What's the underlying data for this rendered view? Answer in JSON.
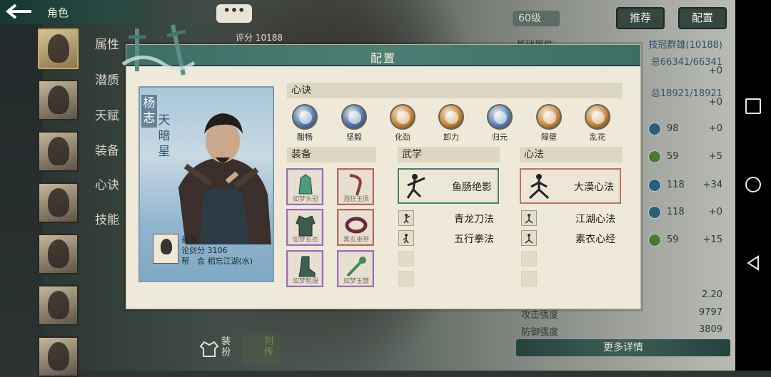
{
  "top": {
    "back_icon": "back-arrow-icon",
    "title": "角色"
  },
  "sidebar_tabs": [
    "属性",
    "潜质",
    "天赋",
    "装备",
    "心诀",
    "技能"
  ],
  "chat_bubble": "•••",
  "score_text": "评分 10188",
  "level": "60级",
  "buttons": {
    "recommend": "推荐",
    "config": "配置"
  },
  "stats": {
    "heading": "基础属性",
    "guild_rank": "技冠群雄(10188)",
    "hp_total": "总66341/66341",
    "hp_bonus": "+0",
    "mp_total": "总18921/18921",
    "mp_bonus": "+0",
    "rows": [
      {
        "value": "98",
        "bonus": "+0"
      },
      {
        "value": "59",
        "bonus": "+5"
      },
      {
        "value": "118",
        "bonus": "+34"
      },
      {
        "value": "118",
        "bonus": "+0"
      },
      {
        "value": "59",
        "bonus": "+15"
      }
    ],
    "rate_value": "2.20",
    "attack_label": "攻击强度",
    "attack_value": "9797",
    "defense_label": "防御强度",
    "defense_value": "3809",
    "more_label": "更多详情"
  },
  "bottom_buttons": {
    "dress": "装扮",
    "story": "列传"
  },
  "dialog": {
    "title": "配置",
    "hero": {
      "name": "杨志",
      "title": "天暗星",
      "guild_label": "豪義",
      "score_line": "论剑分 3106",
      "gang_line": "帮　会 相忘江湖(水)"
    },
    "xinjue_header": "心诀",
    "xinjue": [
      {
        "label": "酣畅",
        "color": "#4f7fb3"
      },
      {
        "label": "坚毅",
        "color": "#4c78ad"
      },
      {
        "label": "化劲",
        "color": "#c78a3e"
      },
      {
        "label": "卸力",
        "color": "#c4873c"
      },
      {
        "label": "归元",
        "color": "#5a86bc"
      },
      {
        "label": "障壁",
        "color": "#c88d45"
      },
      {
        "label": "乱花",
        "color": "#c3883f"
      }
    ],
    "equip_header": "装备",
    "equipment": [
      {
        "name": "如梦头冠",
        "frame": "purple",
        "color": "#4f9a7a"
      },
      {
        "name": "酒狂玉佩",
        "frame": "red",
        "color": "#8b3a3a"
      },
      {
        "name": "如梦长衣",
        "frame": "purple",
        "color": "#3d5b4c"
      },
      {
        "name": "黑玄束带",
        "frame": "red",
        "color": "#6a2c3a"
      },
      {
        "name": "如梦靴履",
        "frame": "purple",
        "color": "#3e6050"
      },
      {
        "name": "如梦玉簪",
        "frame": "purple",
        "color": "#3d8a5a"
      }
    ],
    "wuxue_header": "武学",
    "wuxue_main": "鱼肠绝影",
    "wuxue_list": [
      "青龙刀法",
      "五行拳法"
    ],
    "xinfa_header": "心法",
    "xinfa_main": "大漠心法",
    "xinfa_list": [
      "江湖心法",
      "素衣心经"
    ]
  }
}
